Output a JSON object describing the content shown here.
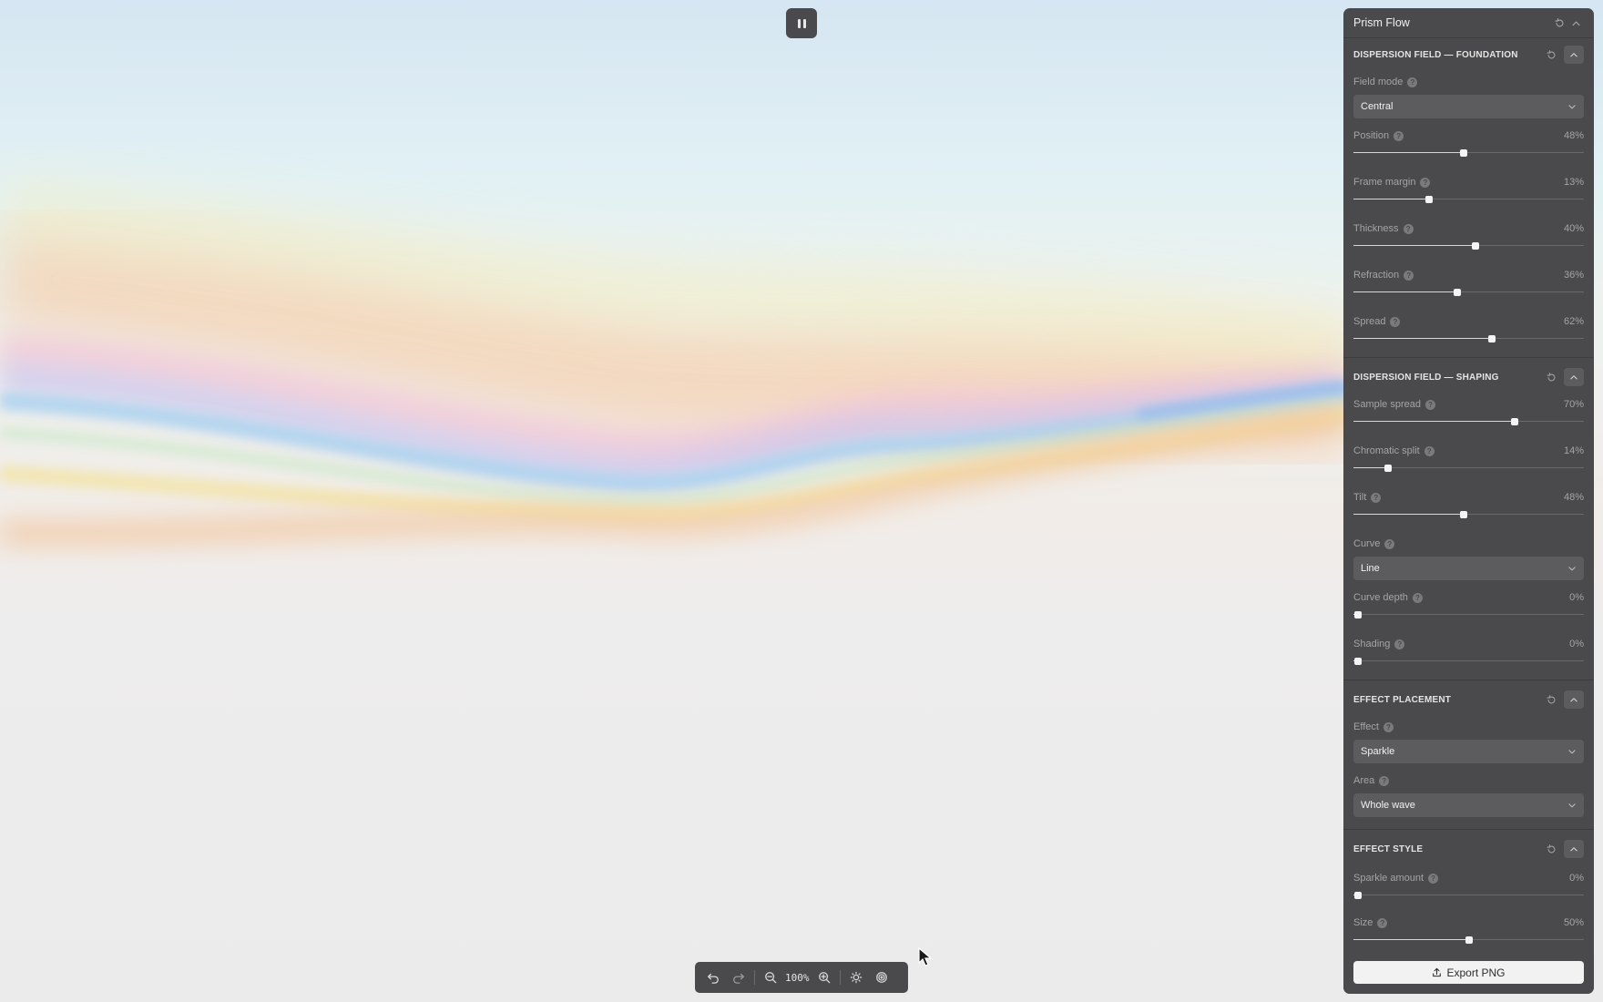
{
  "canvas": {
    "pause_icon": "pause-icon"
  },
  "toolbar": {
    "zoom_level": "100%",
    "icons": [
      "undo-icon",
      "redo-icon",
      "zoom-out-icon",
      "zoom-in-icon",
      "brightness-icon",
      "target-icon"
    ]
  },
  "panel": {
    "title": "Prism Flow",
    "export_label": "Export PNG",
    "sections": [
      {
        "id": "foundation",
        "title": "DISPERSION FIELD — FOUNDATION",
        "controls": [
          {
            "type": "select",
            "label": "Field mode",
            "value": "Central"
          },
          {
            "type": "slider",
            "label": "Position",
            "display": "48%",
            "value": 0.48
          },
          {
            "type": "slider",
            "label": "Frame margin",
            "display": "13%",
            "value": 0.33
          },
          {
            "type": "slider",
            "label": "Thickness",
            "display": "40%",
            "value": 0.53
          },
          {
            "type": "slider",
            "label": "Refraction",
            "display": "36%",
            "value": 0.45
          },
          {
            "type": "slider",
            "label": "Spread",
            "display": "62%",
            "value": 0.6
          }
        ]
      },
      {
        "id": "shaping",
        "title": "DISPERSION FIELD — SHAPING",
        "controls": [
          {
            "type": "slider",
            "label": "Sample spread",
            "display": "70%",
            "value": 0.7
          },
          {
            "type": "slider",
            "label": "Chromatic split",
            "display": "14%",
            "value": 0.15
          },
          {
            "type": "slider",
            "label": "Tilt",
            "display": "48%",
            "value": 0.48
          },
          {
            "type": "select",
            "label": "Curve",
            "value": "Line"
          },
          {
            "type": "slider",
            "label": "Curve depth",
            "display": "0%",
            "value": 0.02
          },
          {
            "type": "slider",
            "label": "Shading",
            "display": "0%",
            "value": 0.02
          }
        ]
      },
      {
        "id": "placement",
        "title": "EFFECT PLACEMENT",
        "controls": [
          {
            "type": "select",
            "label": "Effect",
            "value": "Sparkle"
          },
          {
            "type": "select",
            "label": "Area",
            "value": "Whole wave"
          }
        ]
      },
      {
        "id": "style",
        "title": "EFFECT STYLE",
        "controls": [
          {
            "type": "slider",
            "label": "Sparkle amount",
            "display": "0%",
            "value": 0.02
          },
          {
            "type": "slider",
            "label": "Size",
            "display": "50%",
            "value": 0.5
          }
        ]
      }
    ]
  },
  "colors": {
    "panel_bg": "#4a4a4c",
    "accent": "#f2f2f2"
  }
}
